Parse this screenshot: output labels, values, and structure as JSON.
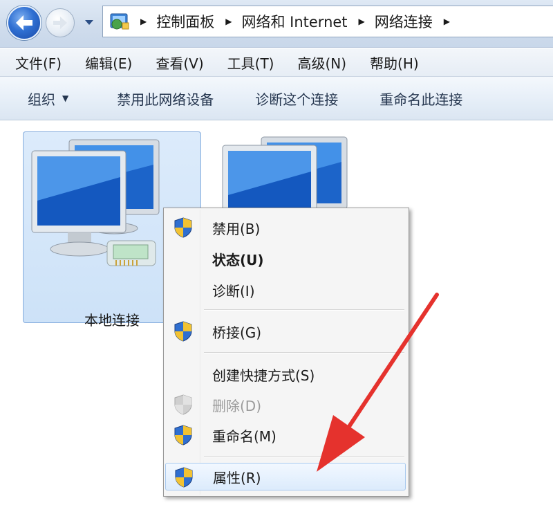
{
  "address_bar": {
    "breadcrumbs": [
      "控制面板",
      "网络和 Internet",
      "网络连接"
    ]
  },
  "menu": {
    "items": [
      "文件(F)",
      "编辑(E)",
      "查看(V)",
      "工具(T)",
      "高级(N)",
      "帮助(H)"
    ]
  },
  "commands": {
    "organize": "组织",
    "disable_device": "禁用此网络设备",
    "diagnose": "诊断这个连接",
    "rename": "重命名此连接"
  },
  "connections": [
    {
      "label": "本地连接",
      "selected": true
    },
    {
      "label": "",
      "selected": false
    }
  ],
  "context_menu": {
    "items": [
      {
        "label": "禁用(B)",
        "icon": "uac-shield-icon"
      },
      {
        "label": "状态(U)",
        "bold": true
      },
      {
        "label": "诊断(I)"
      },
      {
        "label": "桥接(G)",
        "icon": "uac-shield-icon"
      },
      {
        "label": "创建快捷方式(S)"
      },
      {
        "label": "删除(D)",
        "icon": "uac-shield-icon",
        "disabled": true
      },
      {
        "label": "重命名(M)",
        "icon": "uac-shield-icon"
      },
      {
        "label": "属性(R)",
        "icon": "uac-shield-icon",
        "highlighted": true
      }
    ]
  },
  "colors": {
    "annotation_arrow": "#e5322d",
    "selection_fill": "#cde2f8",
    "toolbar_text": "#25364f"
  }
}
